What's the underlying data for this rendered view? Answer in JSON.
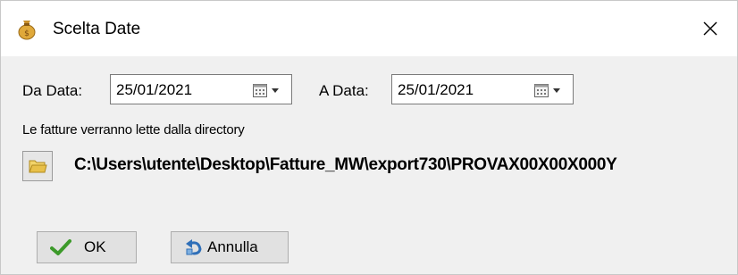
{
  "window": {
    "title": "Scelta Date",
    "close_glyph": "✕"
  },
  "dates": {
    "from_label": "Da Data:",
    "from_value": "25/01/2021",
    "to_label": "A Data:",
    "to_value": "25/01/2021"
  },
  "directory": {
    "info_text": "Le fatture verranno lette dalla directory",
    "path": "C:\\Users\\utente\\Desktop\\Fatture_MW\\export730\\PROVAX00X00X000Y"
  },
  "buttons": {
    "ok_label": "OK",
    "cancel_label": "Annulla"
  },
  "icons": {
    "title": "money-bag-icon",
    "calendar": "calendar-icon",
    "dropdown": "dropdown-arrow-icon",
    "folder": "folder-icon",
    "ok": "checkmark-icon",
    "cancel": "undo-icon"
  },
  "colors": {
    "client_bg": "#f0f0f0",
    "ok_check": "#3c9a2a",
    "folder": "#e8c04a"
  }
}
